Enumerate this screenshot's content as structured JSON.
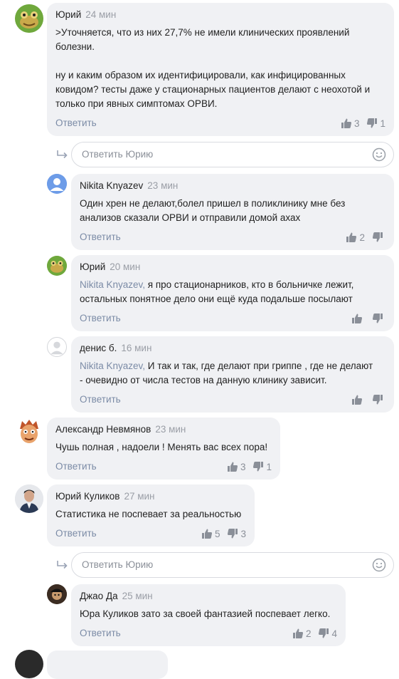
{
  "comments": [
    {
      "author": "Юрий",
      "time": "24 мин",
      "lines": [
        ">Уточняется, что из них 27,7% не имели клинических проявлений",
        "болезни.",
        "",
        "ну и каким образом их идентифицировали, как инфицированных",
        "ковидом?  тесты даже у стационарных пациентов делают с неохотой и",
        "только при явных симптомах ОРВИ."
      ],
      "reply_label": "Ответить",
      "likes": "3",
      "dislikes": "1"
    },
    {
      "author": "Nikita Knyazev",
      "time": "23 мин",
      "lines": [
        "Один хрен не делают,болел пришел в поликлинику мне без",
        "анализов сказали ОРВИ и отправили домой ахах"
      ],
      "reply_label": "Ответить",
      "likes": "2",
      "dislikes": ""
    },
    {
      "author": "Юрий",
      "time": "20 мин",
      "mention": "Nikita Knyazev,",
      "lines": [
        " я про стационарников, кто в больничке лежит,",
        "остальных понятное дело они ещё куда подальше посылают"
      ],
      "reply_label": "Ответить",
      "likes": "",
      "dislikes": ""
    },
    {
      "author": "денис б.",
      "time": "16 мин",
      "mention": "Nikita Knyazev,",
      "lines": [
        " И так и так, где делают при гриппе , где не делают",
        "- очевидно от числа тестов на данную клинику зависит."
      ],
      "reply_label": "Ответить",
      "likes": "",
      "dislikes": ""
    },
    {
      "author": "Александр Невмянов",
      "time": "23 мин",
      "lines": [
        "Чушь полная , надоели ! Менять вас всех пора!"
      ],
      "reply_label": "Ответить",
      "likes": "3",
      "dislikes": "1"
    },
    {
      "author": "Юрий Куликов",
      "time": "27 мин",
      "lines": [
        "Статистика не поспевает за реальностью"
      ],
      "reply_label": "Ответить",
      "likes": "5",
      "dislikes": "3"
    },
    {
      "author": "Джао Да",
      "time": "25 мин",
      "lines": [
        "Юра Куликов зато за своей фантазией поспевает легко."
      ],
      "reply_label": "Ответить",
      "likes": "2",
      "dislikes": "4"
    }
  ],
  "reply_boxes": [
    {
      "placeholder": "Ответить Юрию"
    },
    {
      "placeholder": "Ответить Юрию"
    }
  ],
  "icons": {
    "like": "thumbs-up-icon",
    "dislike": "thumbs-down-icon",
    "emoji": "smile-icon",
    "reply_arrow": "reply-arrow-icon"
  },
  "colors": {
    "bubble": "#f0f1f4",
    "link": "#7b8ba6",
    "muted": "#9a9ea6"
  }
}
